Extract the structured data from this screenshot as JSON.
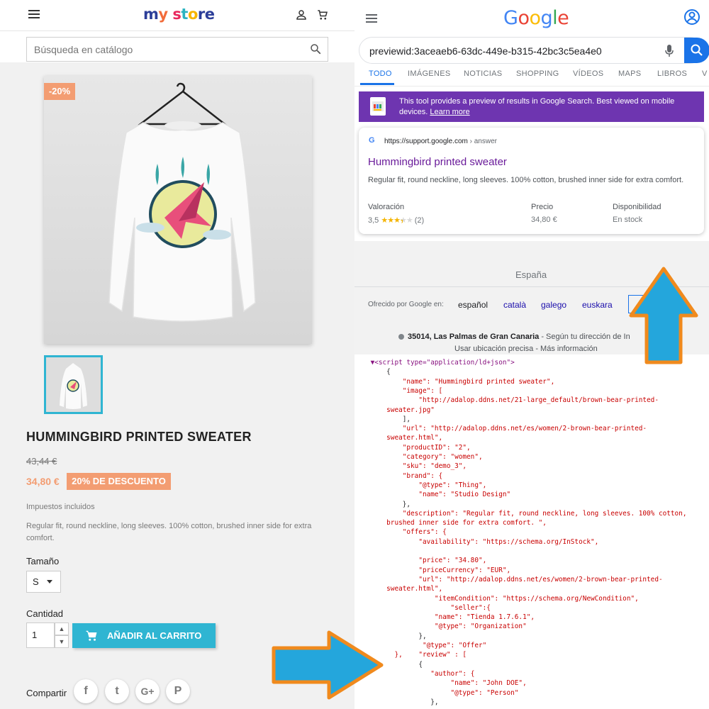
{
  "store": {
    "logo": {
      "my": "my",
      "store": "store"
    },
    "search_placeholder": "Búsqueda en catálogo",
    "discount_flag": "-20%",
    "product_title": "HUMMINGBIRD PRINTED SWEATER",
    "old_price": "43,44 €",
    "new_price": "34,80 €",
    "discount_badge": "20% DE DESCUENTO",
    "tax_note": "Impuestos incluidos",
    "description": "Regular fit, round neckline, long sleeves. 100% cotton, brushed inner side for extra comfort.",
    "size_label": "Tamaño",
    "size_value": "S",
    "quantity_label": "Cantidad",
    "quantity_value": "1",
    "add_to_cart": "AÑADIR AL CARRITO",
    "share_label": "Compartir",
    "social": [
      "f",
      "t",
      "G+",
      "P"
    ],
    "colors": {
      "accent": "#2fb5d2",
      "discount": "#f39d72"
    }
  },
  "google": {
    "logo": [
      "G",
      "o",
      "o",
      "g",
      "l",
      "e"
    ],
    "query": "previewid:3aceaeb6-63dc-449e-b315-42bc3c5ea4e0",
    "tabs": [
      "TODO",
      "IMÁGENES",
      "NOTICIAS",
      "SHOPPING",
      "VÍDEOS",
      "MAPS",
      "LIBROS",
      "V"
    ],
    "banner": {
      "text": "This tool provides a preview of results in Google Search. Best viewed on mobile devices.",
      "link": "Learn more"
    },
    "result": {
      "url": "https://support.google.com",
      "path": " › answer",
      "title": "Hummingbird printed sweater",
      "snippet": "Regular fit, round neckline, long sleeves. 100% cotton, brushed inner side for extra comfort.",
      "rating_label": "Valoración",
      "rating_value": "3,5",
      "rating_count": "(2)",
      "price_label": "Precio",
      "price_value": "34,80 €",
      "avail_label": "Disponibilidad",
      "avail_value": "En stock",
      "stars": 3.5
    },
    "country": "España",
    "offered_by": "Ofrecido por Google en:",
    "languages": [
      "español",
      "català",
      "galego",
      "euskara"
    ],
    "location": {
      "place": "35014, Las Palmas de Gran Canaria",
      "suffix": " - Según tu dirección de In",
      "links": "Usar ubicación precisa - Más información"
    },
    "colors": {
      "blue": "#1a73e8",
      "banner": "#6e35b0",
      "title": "#6a1b9a"
    }
  },
  "code_lines": [
    {
      "i": "    ",
      "t": "▼<script type=\"application/ld+json\">",
      "k": "tag"
    },
    {
      "i": "        ",
      "t": "{",
      "k": "black"
    },
    {
      "i": "            ",
      "t": "\"name\": \"Hummingbird printed sweater\",",
      "k": "str"
    },
    {
      "i": "            ",
      "t": "\"image\": [",
      "k": "str"
    },
    {
      "i": "                ",
      "t": "\"http://adalop.ddns.net/21-large_default/brown-bear-printed-",
      "k": "str"
    },
    {
      "i": "        ",
      "t": "sweater.jpg\"",
      "k": "str"
    },
    {
      "i": "            ",
      "t": "],",
      "k": "black"
    },
    {
      "i": "            ",
      "t": "\"url\": \"http://adalop.ddns.net/es/women/2-brown-bear-printed-",
      "k": "str"
    },
    {
      "i": "        ",
      "t": "sweater.html\",",
      "k": "str"
    },
    {
      "i": "            ",
      "t": "\"productID\": \"2\",",
      "k": "str"
    },
    {
      "i": "            ",
      "t": "\"category\": \"women\",",
      "k": "str"
    },
    {
      "i": "            ",
      "t": "\"sku\": \"demo_3\",",
      "k": "str"
    },
    {
      "i": "            ",
      "t": "\"brand\": {",
      "k": "str"
    },
    {
      "i": "                ",
      "t": "\"@type\": \"Thing\",",
      "k": "str"
    },
    {
      "i": "                ",
      "t": "\"name\": \"Studio Design\"",
      "k": "str"
    },
    {
      "i": "            ",
      "t": "},",
      "k": "black"
    },
    {
      "i": "            ",
      "t": "\"description\": \"Regular fit, round neckline, long sleeves. 100% cotton,",
      "k": "str"
    },
    {
      "i": "        ",
      "t": "brushed inner side for extra comfort. \",",
      "k": "str"
    },
    {
      "i": "            ",
      "t": "\"offers\": {",
      "k": "str"
    },
    {
      "i": "                ",
      "t": "\"availability\": \"https://schema.org/InStock\",",
      "k": "str"
    },
    {
      "i": "",
      "t": "",
      "k": "str"
    },
    {
      "i": "                ",
      "t": "\"price\": \"34.80\",",
      "k": "str"
    },
    {
      "i": "                ",
      "t": "\"priceCurrency\": \"EUR\",",
      "k": "str"
    },
    {
      "i": "                ",
      "t": "\"url\": \"http://adalop.ddns.net/es/women/2-brown-bear-printed-",
      "k": "str"
    },
    {
      "i": "        ",
      "t": "sweater.html\",",
      "k": "str"
    },
    {
      "i": "                    ",
      "t": "\"itemCondition\": \"https://schema.org/NewCondition\",",
      "k": "str"
    },
    {
      "i": "                        ",
      "t": "\"seller\":{",
      "k": "str"
    },
    {
      "i": "                    ",
      "t": "\"name\": \"Tienda 1.7.6.1\",",
      "k": "str"
    },
    {
      "i": "                    ",
      "t": "\"@type\": \"Organization\"",
      "k": "str"
    },
    {
      "i": "                ",
      "t": "},",
      "k": "black"
    },
    {
      "i": "                 ",
      "t": "\"@type\": \"Offer\"",
      "k": "str"
    },
    {
      "i": "          ",
      "t": "},    \"review\" : [",
      "k": "str"
    },
    {
      "i": "                ",
      "t": "{",
      "k": "black"
    },
    {
      "i": "                   ",
      "t": "\"author\": {",
      "k": "str"
    },
    {
      "i": "                        ",
      "t": "\"name\": \"John DOE\",",
      "k": "str"
    },
    {
      "i": "                        ",
      "t": "\"@type\": \"Person\"",
      "k": "str"
    },
    {
      "i": "                   ",
      "t": "},",
      "k": "black"
    }
  ]
}
